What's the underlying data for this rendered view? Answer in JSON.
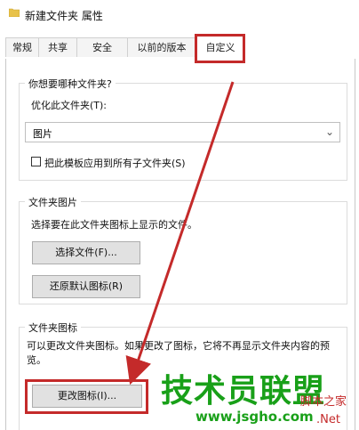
{
  "window": {
    "title": "新建文件夹 属性"
  },
  "tabs": [
    {
      "label": "常规"
    },
    {
      "label": "共享"
    },
    {
      "label": "安全"
    },
    {
      "label": "以前的版本"
    },
    {
      "label": "自定义"
    }
  ],
  "folder_type": {
    "heading": "你想要哪种文件夹?",
    "optimize_label": "优化此文件夹(T):",
    "selected": "图片",
    "apply_subfolders_label": "把此模板应用到所有子文件夹(S)"
  },
  "folder_pictures": {
    "heading": "文件夹图片",
    "description": "选择要在此文件夹图标上显示的文件。",
    "choose_file_button": "选择文件(F)...",
    "restore_default_button": "还原默认图标(R)"
  },
  "folder_icons": {
    "heading": "文件夹图标",
    "description": "可以更改文件夹图标。如果更改了图标，它将不再显示文件夹内容的预览。",
    "change_icon_button": "更改图标(I)..."
  },
  "watermark": {
    "main": "技术员联盟",
    "sub": "脚本之家",
    "url": "www.jsgho.com",
    "net": ".Net"
  },
  "colors": {
    "highlight": "#c42a2a",
    "watermark_green": "#19a019"
  },
  "icons": [
    "folder-icon",
    "chevron-down-icon",
    "checkbox-icon",
    "arrow-annotation"
  ]
}
